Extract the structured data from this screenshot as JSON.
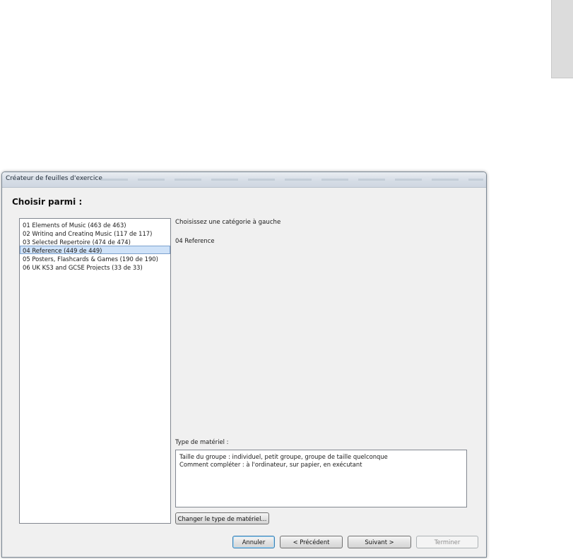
{
  "window": {
    "title": "Créateur de feuilles d'exercice",
    "heading": "Choisir parmi :"
  },
  "categories": [
    {
      "label": "01 Elements of Music (463 de 463)",
      "selected": false
    },
    {
      "label": "02 Writing and Creating Music (117 de 117)",
      "selected": false
    },
    {
      "label": "03 Selected Repertoire (474 de 474)",
      "selected": false
    },
    {
      "label": "04 Reference (449 de 449)",
      "selected": true
    },
    {
      "label": "05 Posters, Flashcards & Games (190 de 190)",
      "selected": false
    },
    {
      "label": "06 UK KS3 and GCSE Projects (33 de 33)",
      "selected": false
    }
  ],
  "detail": {
    "prompt": "Choisissez une catégorie à gauche",
    "selected_category": "04 Reference"
  },
  "material": {
    "label": "Type de matériel :",
    "lines": [
      "Taille du groupe :  individuel, petit groupe, groupe de taille quelconque",
      "Comment compléter :  à l'ordinateur, sur papier, en exécutant"
    ],
    "change_button": "Changer le type de matériel..."
  },
  "buttons": {
    "cancel": "Annuler",
    "previous": "< Précédent",
    "next": "Suivant >",
    "finish": "Terminer"
  }
}
